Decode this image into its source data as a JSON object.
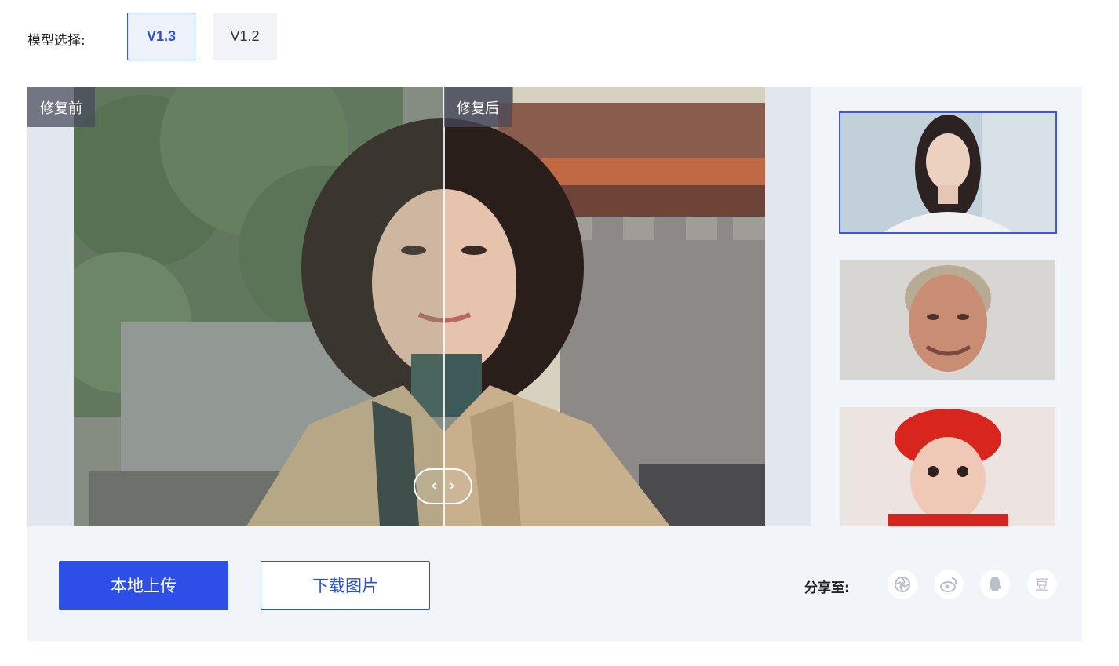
{
  "model_select": {
    "label": "模型选择:",
    "options": [
      {
        "label": "V1.3",
        "active": true
      },
      {
        "label": "V1.2",
        "active": false
      }
    ]
  },
  "viewer": {
    "before_label": "修复前",
    "after_label": "修复后",
    "handle_left": "‹",
    "handle_right": "›"
  },
  "thumbnails": [
    {
      "name": "young-woman-portrait",
      "selected": true
    },
    {
      "name": "older-man-portrait",
      "selected": false
    },
    {
      "name": "child-red-hat-portrait",
      "selected": false
    }
  ],
  "actions": {
    "upload_label": "本地上传",
    "download_label": "下载图片"
  },
  "share": {
    "label": "分享至:",
    "icons": [
      "camera-aperture-icon",
      "weibo-icon",
      "qq-icon"
    ],
    "douban_glyph": "豆"
  },
  "colors": {
    "accent": "#2d4fe8",
    "panel_bg": "#f1f4f9",
    "selected_border": "#3a57e8"
  }
}
